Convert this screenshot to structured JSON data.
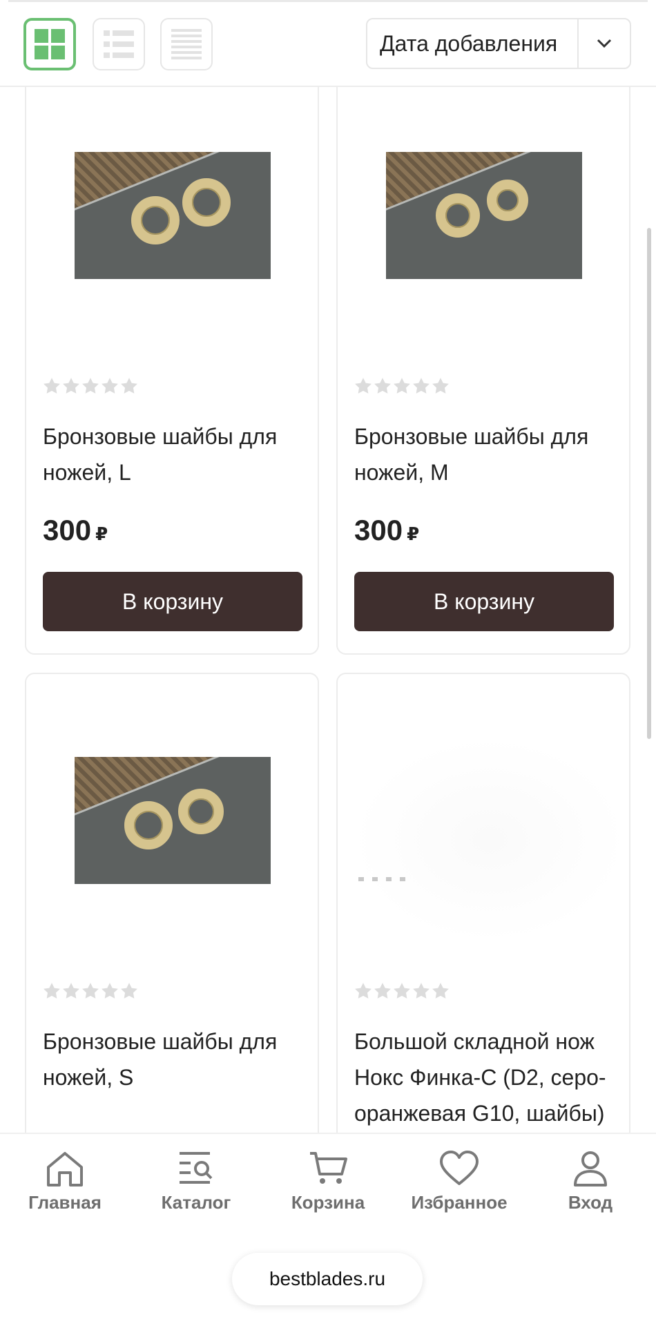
{
  "toolbar": {
    "view_modes": [
      {
        "name": "grid",
        "active": true
      },
      {
        "name": "list",
        "active": false
      },
      {
        "name": "compact-list",
        "active": false
      }
    ],
    "sort": {
      "label": "Дата добавления"
    }
  },
  "colors": {
    "accent_green": "#6abf72",
    "button_dark": "#3f2f2e",
    "star_empty": "#dcdcdc"
  },
  "products": [
    {
      "title": "Бронзовые шайбы для ножей, L",
      "price": "300",
      "currency": "₽",
      "button": "В корзину",
      "rating": 0
    },
    {
      "title": "Бронзовые шайбы для ножей, M",
      "price": "300",
      "currency": "₽",
      "button": "В корзину",
      "rating": 0
    },
    {
      "title": "Бронзовые шайбы для ножей, S",
      "rating": 0
    },
    {
      "title": "Большой складной нож Нокс Финка-С (D2, серо-оранжевая G10, шайбы)",
      "rating": 0
    }
  ],
  "bottom_nav": {
    "items": [
      {
        "label": "Главная",
        "icon": "home-icon"
      },
      {
        "label": "Каталог",
        "icon": "catalog-search-icon"
      },
      {
        "label": "Корзина",
        "icon": "cart-icon"
      },
      {
        "label": "Избранное",
        "icon": "heart-icon"
      },
      {
        "label": "Вход",
        "icon": "user-icon"
      }
    ]
  },
  "browser": {
    "url": "bestblades.ru"
  }
}
